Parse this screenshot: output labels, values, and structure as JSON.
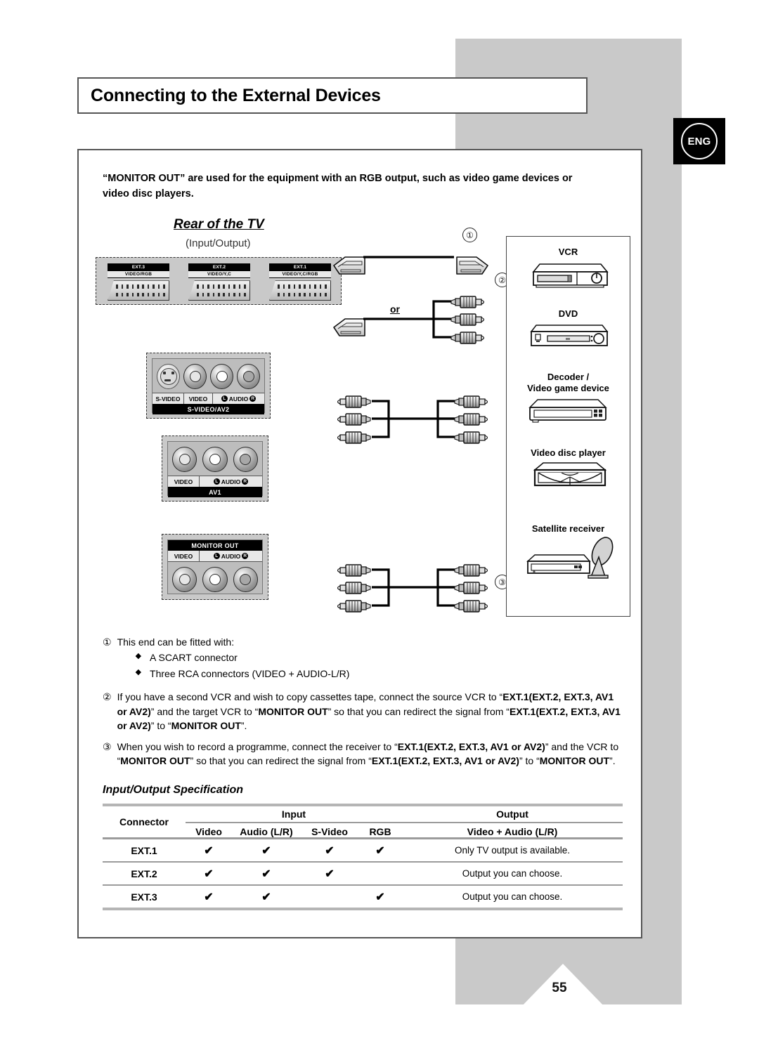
{
  "page": {
    "title": "Connecting to the External Devices",
    "language_badge": "ENG",
    "page_number": "55"
  },
  "intro": {
    "text": "“MONITOR OUT” are used for the equipment with an RGB output, such as video game devices or video disc players."
  },
  "diagram": {
    "heading": "Rear of the TV",
    "subheading": "(Input/Output)",
    "marker_1": "①",
    "marker_2": "②",
    "marker_3": "③",
    "or_label": "or",
    "scart_connectors": [
      {
        "name": "EXT.3",
        "signal": "VIDEO/RGB"
      },
      {
        "name": "EXT.2",
        "signal": "VIDEO/Y,C"
      },
      {
        "name": "EXT.1",
        "signal": "VIDEO/Y,C/RGB"
      }
    ],
    "panels": [
      {
        "id": "s-video-av2",
        "bar_label": "S-VIDEO/AV2",
        "bar_position": "bottom",
        "jack_labels": [
          "S-VIDEO",
          "VIDEO",
          "AUDIO"
        ],
        "audio_left": "L",
        "audio_right": "R"
      },
      {
        "id": "av1",
        "bar_label": "AV1",
        "bar_position": "bottom",
        "jack_labels": [
          "VIDEO",
          "AUDIO"
        ],
        "audio_left": "L",
        "audio_right": "R"
      },
      {
        "id": "monitor-out",
        "bar_label": "MONITOR OUT",
        "bar_position": "top",
        "jack_labels": [
          "VIDEO",
          "AUDIO"
        ],
        "audio_left": "L",
        "audio_right": "R"
      }
    ],
    "devices": [
      {
        "label": "VCR"
      },
      {
        "label": "DVD"
      },
      {
        "label": "Decoder /\nVideo game device"
      },
      {
        "label": "Video disc player"
      },
      {
        "label": "Satellite receiver"
      }
    ]
  },
  "notes": [
    {
      "marker": "①",
      "text": "This end can be fitted with:",
      "bullets": [
        "A SCART connector",
        "Three RCA connectors (VIDEO + AUDIO-L/R)"
      ]
    },
    {
      "marker": "②",
      "html": "If you have a second VCR and wish to copy cassettes tape, connect the source VCR to “<b class=\"k\">EXT.1(EXT.2, EXT.3, AV1 or AV2)</b>” and the target VCR to “<b class=\"k\">MONITOR OUT</b>” so that you can redirect the signal from “<b class=\"k\">EXT.1(EXT.2, EXT.3, AV1 or AV2)</b>” to “<b class=\"k\">MONITOR OUT</b>”."
    },
    {
      "marker": "③",
      "html": "When you wish to record a programme, connect the receiver to “<b class=\"k\">EXT.1(EXT.2, EXT.3, AV1 or AV2)</b>” and the VCR to “<b class=\"k\">MONITOR OUT</b>” so that you can redirect the signal from “<b class=\"k\">EXT.1(EXT.2, EXT.3, AV1 or AV2)</b>” to “<b class=\"k\">MONITOR OUT</b>”."
    }
  ],
  "spec": {
    "heading": "Input/Output Specification",
    "col_connector": "Connector",
    "group_input": "Input",
    "group_output": "Output",
    "input_columns": [
      "Video",
      "Audio (L/R)",
      "S-Video",
      "RGB"
    ],
    "output_column": "Video + Audio (L/R)",
    "check_mark": "✔",
    "rows": [
      {
        "connector": "EXT.1",
        "video": true,
        "audio": true,
        "svideo": true,
        "rgb": true,
        "output": "Only TV output is available."
      },
      {
        "connector": "EXT.2",
        "video": true,
        "audio": true,
        "svideo": true,
        "rgb": false,
        "output": "Output you can choose."
      },
      {
        "connector": "EXT.3",
        "video": true,
        "audio": true,
        "svideo": false,
        "rgb": true,
        "output": "Output you can choose."
      }
    ]
  }
}
